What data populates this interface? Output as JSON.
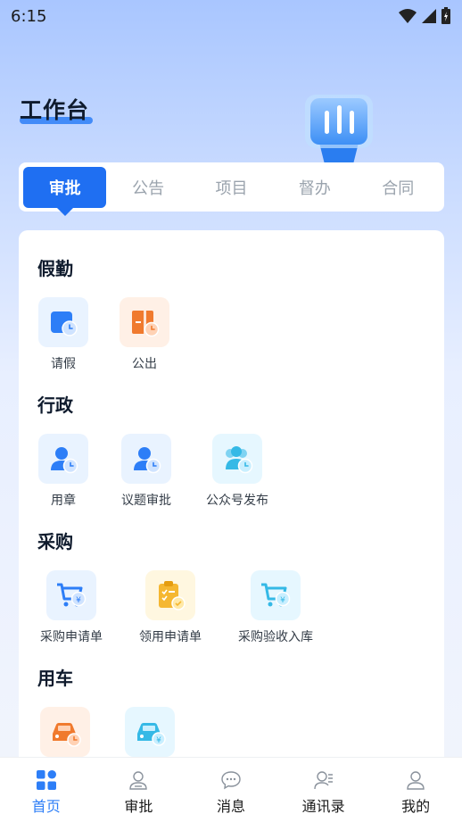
{
  "status_bar": {
    "time": "6:15"
  },
  "header": {
    "title": "工作台"
  },
  "tabs": [
    {
      "label": "审批",
      "active": true
    },
    {
      "label": "公告",
      "active": false
    },
    {
      "label": "项目",
      "active": false
    },
    {
      "label": "督办",
      "active": false
    },
    {
      "label": "合同",
      "active": false
    }
  ],
  "sections": [
    {
      "title": "假勤",
      "items": [
        {
          "label": "请假",
          "icon": "calendar-clock-icon"
        },
        {
          "label": "公出",
          "icon": "exit-door-icon"
        }
      ]
    },
    {
      "title": "行政",
      "items": [
        {
          "label": "用章",
          "icon": "person-clock-icon"
        },
        {
          "label": "议题审批",
          "icon": "person-clock-icon"
        },
        {
          "label": "公众号发布",
          "icon": "group-clock-icon"
        }
      ]
    },
    {
      "title": "采购",
      "items": [
        {
          "label": "采购申请单",
          "icon": "cart-yen-icon"
        },
        {
          "label": "领用申请单",
          "icon": "clipboard-check-icon"
        },
        {
          "label": "采购验收入库",
          "icon": "cart-yen-icon"
        }
      ]
    },
    {
      "title": "用车",
      "items": [
        {
          "label": "",
          "icon": "car-clock-icon"
        },
        {
          "label": "",
          "icon": "car-yen-icon"
        }
      ]
    }
  ],
  "bottom_nav": [
    {
      "label": "首页",
      "icon": "home-grid-icon",
      "active": true
    },
    {
      "label": "审批",
      "icon": "approval-person-icon",
      "active": false
    },
    {
      "label": "消息",
      "icon": "message-bubble-icon",
      "active": false
    },
    {
      "label": "通讯录",
      "icon": "contacts-icon",
      "active": false
    },
    {
      "label": "我的",
      "icon": "profile-icon",
      "active": false
    }
  ],
  "colors": {
    "accent": "#1f6ff2",
    "icon_blue": "#2d7ef7",
    "icon_orange": "#f07a2e",
    "icon_yellow": "#f5b731",
    "icon_cyan": "#35b9e6"
  }
}
